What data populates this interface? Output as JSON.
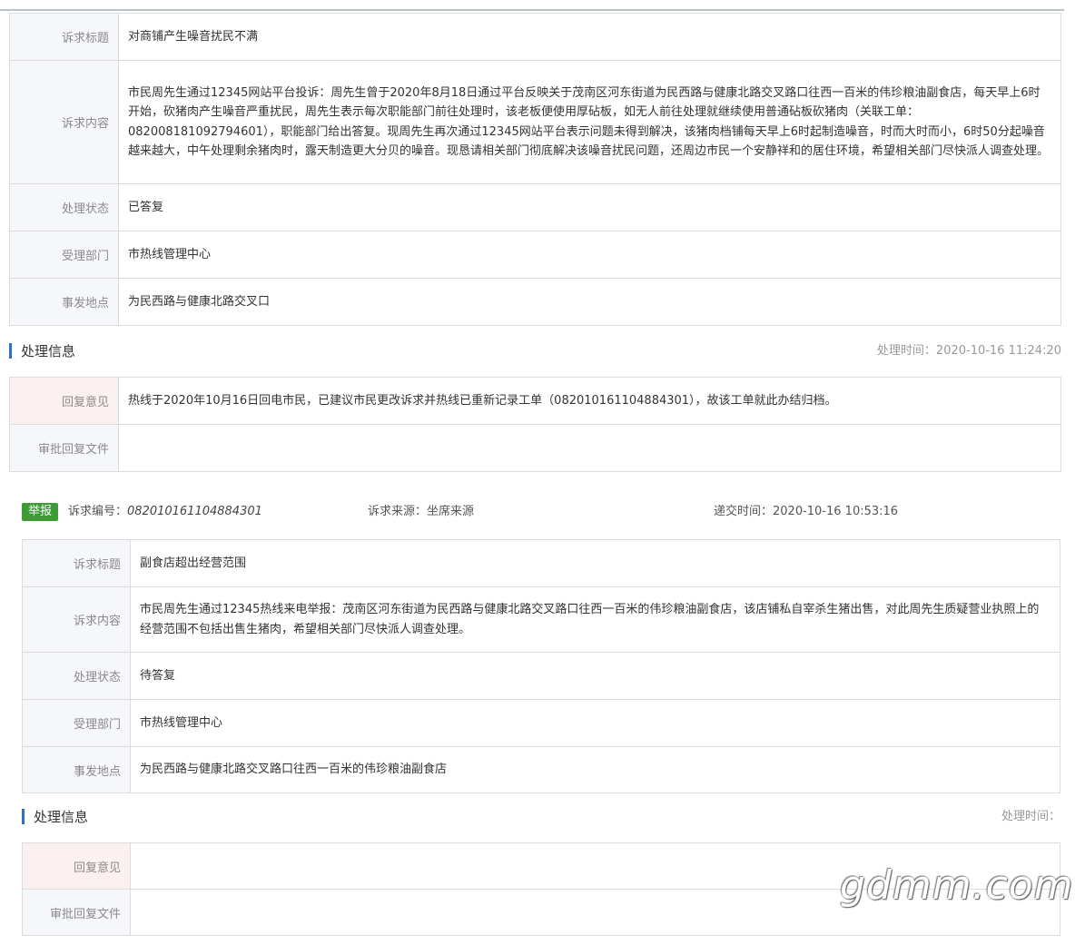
{
  "case1": {
    "labels": {
      "title": "诉求标题",
      "content": "诉求内容",
      "status": "处理状态",
      "dept": "受理部门",
      "location": "事发地点"
    },
    "title": "对商铺产生噪音扰民不满",
    "content": "市民周先生通过12345网站平台投诉：周先生曾于2020年8月18日通过平台反映关于茂南区河东街道为民西路与健康北路交叉路口往西一百米的伟珍粮油副食店，每天早上6时开始，砍猪肉产生噪音严重扰民，周先生表示每次职能部门前往处理时，该老板便使用厚砧板，如无人前往处理就继续使用普通砧板砍猪肉（关联工单：082008181092794601），职能部门给出答复。现周先生再次通过12345网站平台表示问题未得到解决，该猪肉档铺每天早上6时起制造噪音，时而大时而小，6时50分起噪音越来越大，中午处理剩余猪肉时，露天制造更大分贝的噪音。现恳请相关部门彻底解决该噪音扰民问题，还周边市民一个安静祥和的居住环境，希望相关部门尽快派人调查处理。",
    "status": "已答复",
    "dept": "市热线管理中心",
    "location": "为民西路与健康北路交叉口"
  },
  "processing1": {
    "heading": "处理信息",
    "time": "处理时间：2020-10-16 11:24:20",
    "labels": {
      "reply": "回复意见",
      "files": "审批回复文件"
    },
    "reply": "热线于2020年10月16日回电市民，已建议市民更改诉求并热线已重新记录工单（082010161104884301），故该工单就此办结归档。",
    "files": ""
  },
  "case2_meta": {
    "badge": "举报",
    "number_label": "诉求编号：",
    "number": "082010161104884301",
    "source": "诉求来源：坐席来源",
    "submit_time": "递交时间：2020-10-16 10:53:16"
  },
  "case2": {
    "labels": {
      "title": "诉求标题",
      "content": "诉求内容",
      "status": "处理状态",
      "dept": "受理部门",
      "location": "事发地点"
    },
    "title": "副食店超出经营范围",
    "content": "市民周先生通过12345热线来电举报：茂南区河东街道为民西路与健康北路交叉路口往西一百米的伟珍粮油副食店，该店铺私自宰杀生猪出售，对此周先生质疑营业执照上的经营范围不包括出售生猪肉，希望相关部门尽快派人调查处理。",
    "status": "待答复",
    "dept": "市热线管理中心",
    "location": "为民西路与健康北路交叉路口往西一百米的伟珍粮油副食店"
  },
  "processing2": {
    "heading": "处理信息",
    "time": "处理时间：",
    "labels": {
      "reply": "回复意见",
      "files": "审批回复文件"
    },
    "reply": "",
    "files": ""
  },
  "watermark": "gdmm.com",
  "colors": {
    "accent": "#2f6fbf",
    "badge": "#3d9a36",
    "status_green": "#3a8a2b",
    "label_bg": "#f5f7fa",
    "reply_label_bg": "#fbf0f0"
  }
}
